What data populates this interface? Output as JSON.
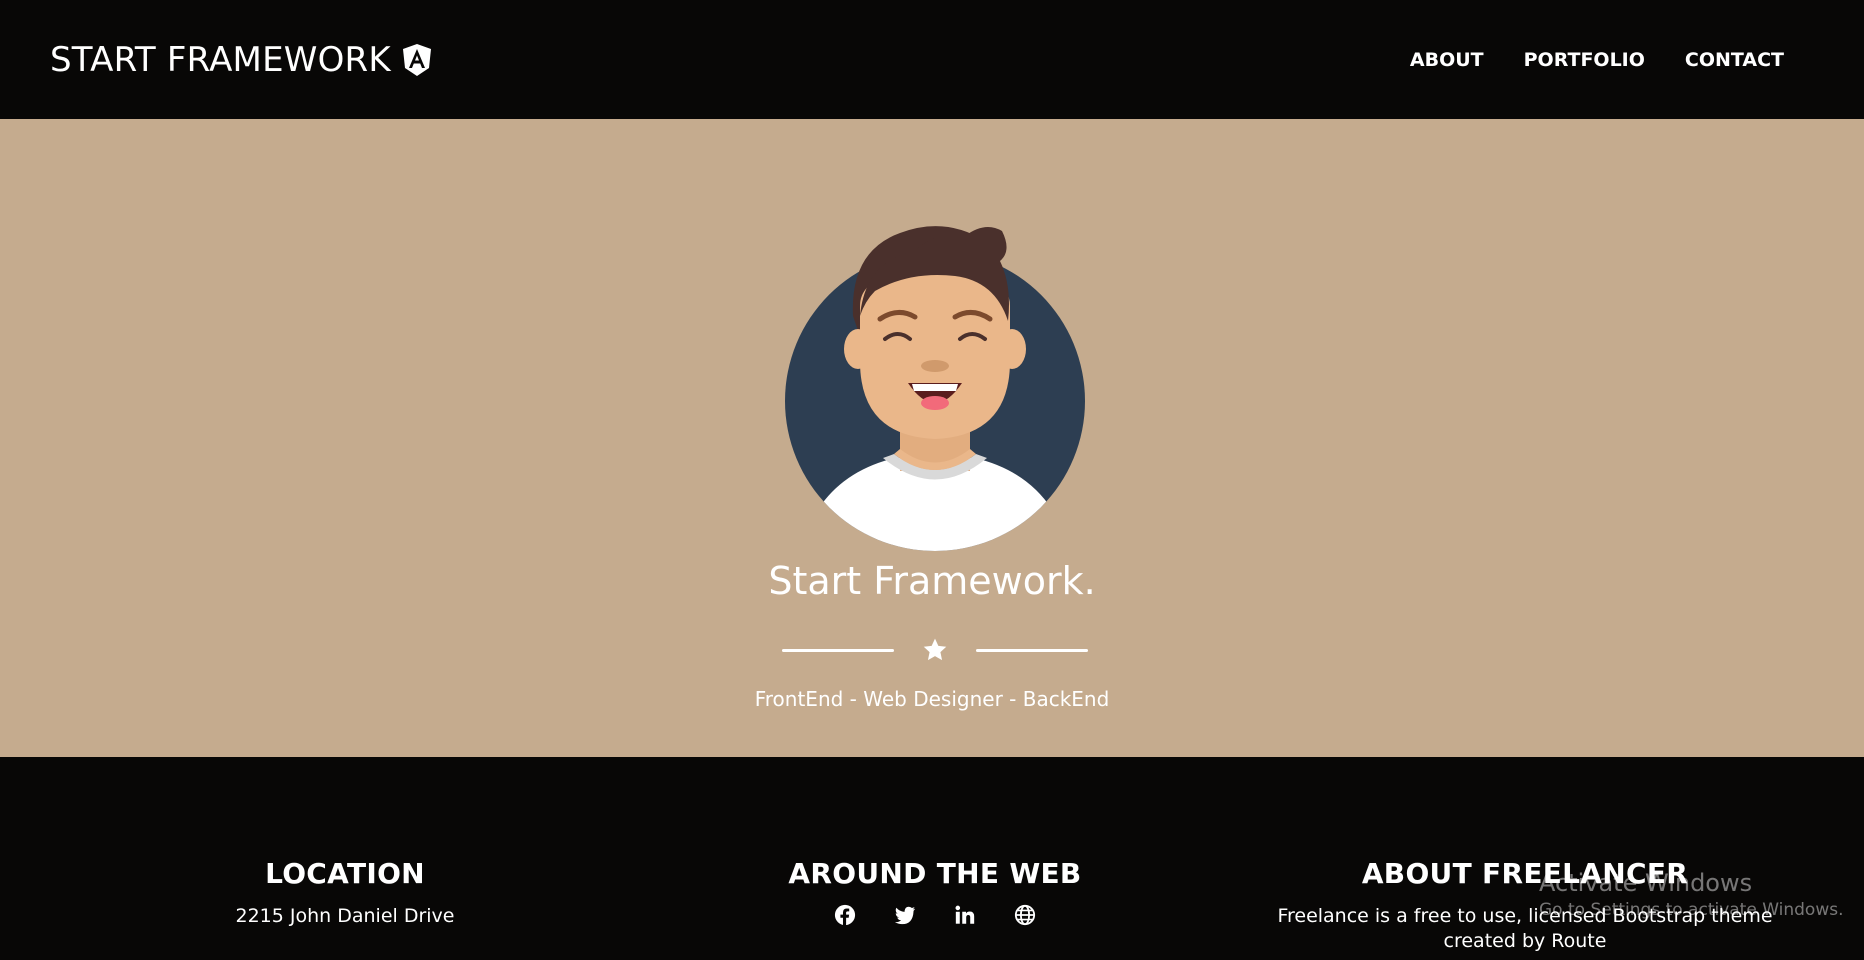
{
  "navbar": {
    "brand": "START FRAMEWORK",
    "brand_icon": "angular-shield-icon",
    "links": [
      {
        "label": "ABOUT"
      },
      {
        "label": "PORTFOLIO"
      },
      {
        "label": "CONTACT"
      }
    ]
  },
  "hero": {
    "title": "Start Framework.",
    "subtitle": "FrontEnd - Web Designer - BackEnd",
    "divider_icon": "star-icon",
    "avatar_icon": "avatar-illustration"
  },
  "footer": {
    "location": {
      "heading": "LOCATION",
      "text": "2215 John Daniel Drive"
    },
    "web": {
      "heading": "AROUND THE WEB",
      "icons": [
        "facebook-icon",
        "twitter-icon",
        "linkedin-icon",
        "globe-icon"
      ]
    },
    "about": {
      "heading": "ABOUT FREELANCER",
      "text_line1": "Freelance is a free to use, licensed Bootstrap theme",
      "text_line2": "created by Route"
    }
  },
  "watermark": {
    "title": "Activate Windows",
    "subtitle": "Go to Settings to activate Windows."
  },
  "colors": {
    "nav_bg": "#080706",
    "hero_bg": "#c5ab8e",
    "text": "#ffffff",
    "avatar_bg": "#2d3e52"
  }
}
